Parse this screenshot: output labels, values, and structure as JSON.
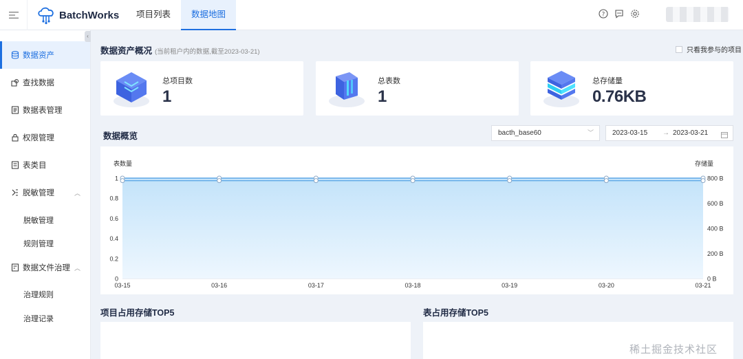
{
  "app": {
    "name": "BatchWorks"
  },
  "nav": {
    "tabs": [
      {
        "label": "项目列表"
      },
      {
        "label": "数据地图"
      }
    ]
  },
  "user": {
    "name_masked": ""
  },
  "sidebar": {
    "items": [
      {
        "label": "数据资产"
      },
      {
        "label": "查找数据"
      },
      {
        "label": "数据表管理"
      },
      {
        "label": "权限管理"
      },
      {
        "label": "表类目"
      },
      {
        "label": "脱敏管理"
      },
      {
        "label": "数据文件治理"
      }
    ],
    "sub_masking": [
      {
        "label": "脱敏管理"
      },
      {
        "label": "规则管理"
      }
    ],
    "sub_governance": [
      {
        "label": "治理规则"
      },
      {
        "label": "治理记录"
      }
    ]
  },
  "overview": {
    "title": "数据资产概况",
    "note": "(当前租户内的数据,截至2023-03-21)",
    "only_mine_label": "只看我参与的项目",
    "cards": [
      {
        "label": "总项目数",
        "value": "1"
      },
      {
        "label": "总表数",
        "value": "1"
      },
      {
        "label": "总存储量",
        "value": "0.76KB"
      }
    ]
  },
  "data_overview": {
    "title": "数据概览",
    "project_select": "bacth_base60",
    "date_start": "2023-03-15",
    "date_end": "2023-03-21"
  },
  "chart_data": {
    "type": "line",
    "x": [
      "03-15",
      "03-16",
      "03-17",
      "03-18",
      "03-19",
      "03-20",
      "03-21"
    ],
    "left_axis": {
      "label": "表数量",
      "ticks": [
        "0",
        "0.2",
        "0.4",
        "0.6",
        "0.8",
        "1"
      ],
      "range": [
        0,
        1
      ]
    },
    "right_axis": {
      "label": "存储量",
      "ticks": [
        "0 B",
        "200 B",
        "400 B",
        "600 B",
        "800 B"
      ],
      "range": [
        0,
        800
      ]
    },
    "series": [
      {
        "axis": "left",
        "type": "area",
        "values": [
          1,
          1,
          1,
          1,
          1,
          1,
          1
        ]
      },
      {
        "axis": "right",
        "type": "line",
        "values": [
          780,
          780,
          780,
          780,
          780,
          780,
          780
        ]
      }
    ],
    "colors": {
      "line": "#5fa8e6",
      "area_top": "#cfe8fb",
      "area_bottom": "#eef7fe"
    }
  },
  "bottom": {
    "left_title": "项目占用存储TOP5",
    "right_title": "表占用存储TOP5"
  },
  "watermark": "稀土掘金技术社区"
}
